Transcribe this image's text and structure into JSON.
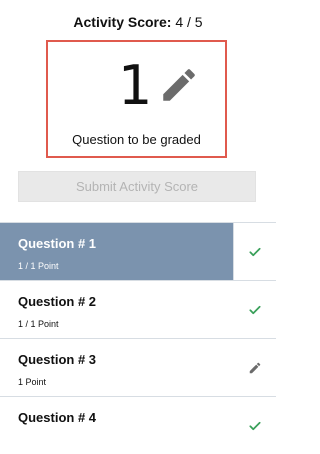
{
  "header": {
    "label": "Activity Score:",
    "value": "4 / 5"
  },
  "grading": {
    "count": "1",
    "caption": "Question to be graded",
    "icon": "pencil-icon"
  },
  "submit": {
    "label": "Submit Activity Score",
    "enabled": false
  },
  "questions": [
    {
      "title": "Question # 1",
      "sub": "1 / 1 Point",
      "status": "check-icon",
      "active": true
    },
    {
      "title": "Question # 2",
      "sub": "1 / 1 Point",
      "status": "check-icon",
      "active": false
    },
    {
      "title": "Question # 3",
      "sub": "1 Point",
      "status": "pencil-icon",
      "active": false
    },
    {
      "title": "Question # 4",
      "sub": "",
      "status": "check-icon",
      "active": false
    }
  ],
  "colors": {
    "accent_border": "#e05a4e",
    "active_row": "#7b93ae",
    "check": "#3aa05a",
    "icon_gray": "#6b6b6b"
  }
}
